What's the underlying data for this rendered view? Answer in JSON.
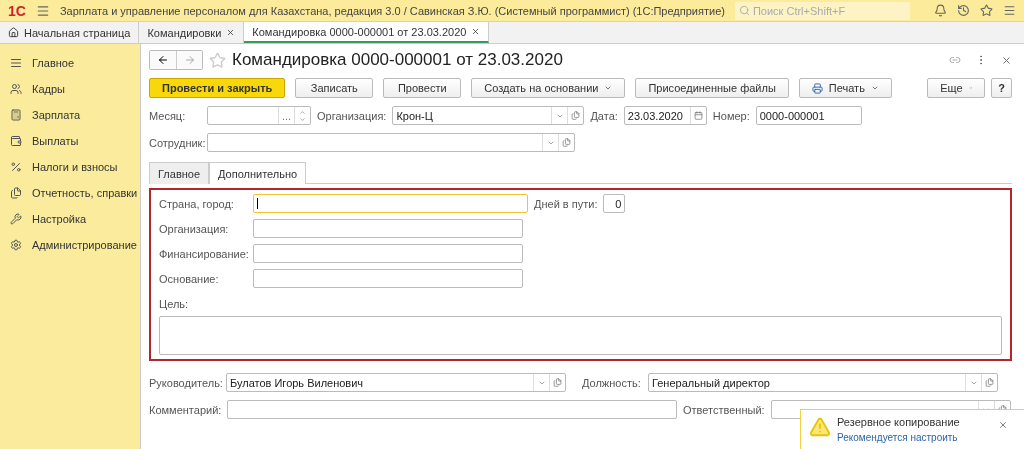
{
  "app": {
    "logo": "1С",
    "title": "Зарплата и управление персоналом для Казахстана, редакция 3.0 / Савинская З.Ю. (Системный программист)  (1С:Предприятие)",
    "search": {
      "placeholder": "Поиск Ctrl+Shift+F"
    }
  },
  "tabs": [
    {
      "label": "Начальная страница",
      "kind": "home",
      "selected": false
    },
    {
      "label": "Командировки",
      "kind": "doc",
      "selected": false
    },
    {
      "label": "Командировка 0000-000001 от 23.03.2020",
      "kind": "doc",
      "selected": true
    }
  ],
  "sidebar": {
    "items": [
      {
        "label": "Главное"
      },
      {
        "label": "Кадры"
      },
      {
        "label": "Зарплата"
      },
      {
        "label": "Выплаты"
      },
      {
        "label": "Налоги и взносы"
      },
      {
        "label": "Отчетность, справки"
      },
      {
        "label": "Настройка"
      },
      {
        "label": "Администрирование"
      }
    ]
  },
  "form": {
    "title": "Командировка 0000-000001 от 23.03.2020",
    "buttons": [
      {
        "label": "Провести и закрыть",
        "kind": "primary"
      },
      {
        "label": "Записать",
        "kind": "plain"
      },
      {
        "label": "Провести",
        "kind": "plain"
      },
      {
        "label": "Создать на основании",
        "kind": "dropdown"
      },
      {
        "label": "Присоединенные файлы",
        "kind": "plain"
      },
      {
        "label": "Печать",
        "kind": "print"
      }
    ],
    "more_button": "Еще",
    "help_button": "?",
    "month": {
      "label": "Месяц:",
      "choose": "..."
    },
    "organization": {
      "label": "Организация:",
      "value": "Крон-Ц"
    },
    "date": {
      "label": "Дата:",
      "value": "23.03.2020"
    },
    "number": {
      "label": "Номер:",
      "value": "0000-000001"
    },
    "employee": {
      "label": "Сотрудник:"
    },
    "page_tabs": [
      {
        "label": "Главное",
        "selected": false
      },
      {
        "label": "Дополнительно",
        "selected": true
      }
    ],
    "extra": {
      "country": {
        "label": "Страна, город:",
        "focused": true
      },
      "days": {
        "label": "Дней в пути:",
        "value": "0"
      },
      "fields": [
        {
          "label": "Организация:"
        },
        {
          "label": "Финансирование:"
        },
        {
          "label": "Основание:"
        }
      ],
      "purpose": {
        "label": "Цель:"
      }
    },
    "head": {
      "label": "Руководитель:",
      "value": "Булатов Игорь Виленович"
    },
    "position": {
      "label": "Должность:",
      "value": "Генеральный директор"
    },
    "comment": {
      "label": "Комментарий:"
    },
    "responsible": {
      "label": "Ответственный:"
    }
  },
  "notification": {
    "title": "Резервное копирование",
    "link": "Рекомендуется настроить"
  }
}
